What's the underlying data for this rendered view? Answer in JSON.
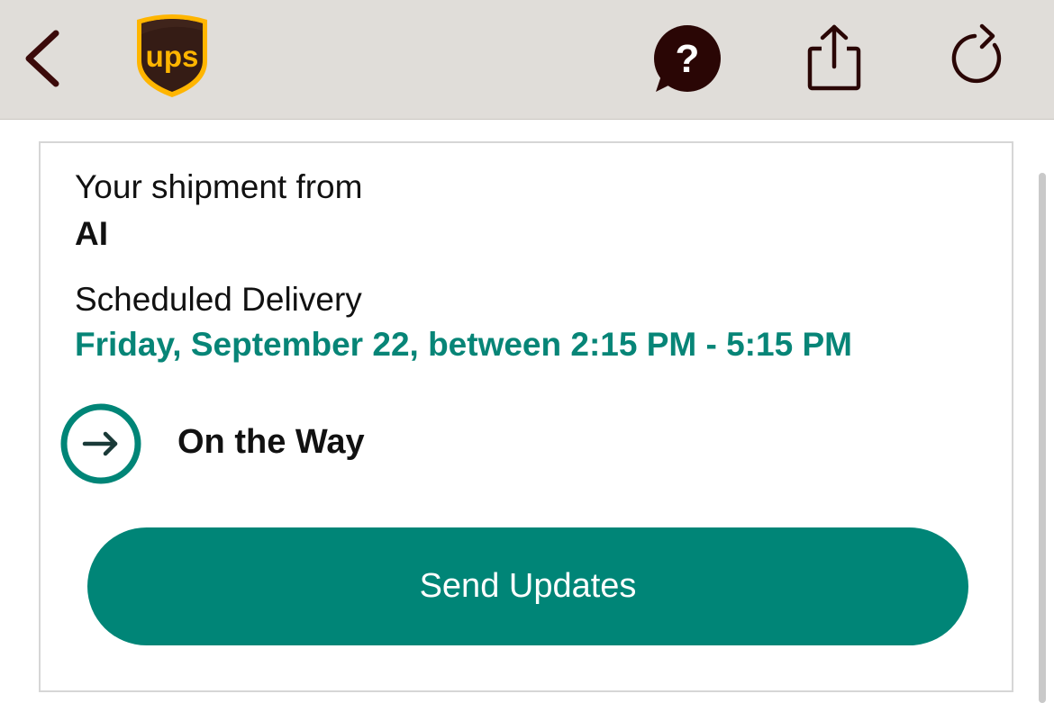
{
  "header": {
    "background": "#e0ddd9",
    "back_icon": "chevron-left-icon",
    "logo_text": "ups",
    "help_icon": "question-bubble-icon",
    "share_icon": "share-icon",
    "refresh_icon": "refresh-icon"
  },
  "shipment": {
    "from_label": "Your shipment from",
    "from_name": "AI",
    "scheduled_label": "Scheduled Delivery",
    "scheduled_date": "Friday, September 22, between 2:15 PM - 5:15 PM",
    "status_icon": "arrow-right-circle-icon",
    "status": "On the Way"
  },
  "actions": {
    "send_updates_label": "Send Updates"
  },
  "colors": {
    "brand_brown": "#351c15",
    "brand_gold": "#ffb500",
    "accent_teal": "#008577",
    "date_teal": "#078577"
  }
}
